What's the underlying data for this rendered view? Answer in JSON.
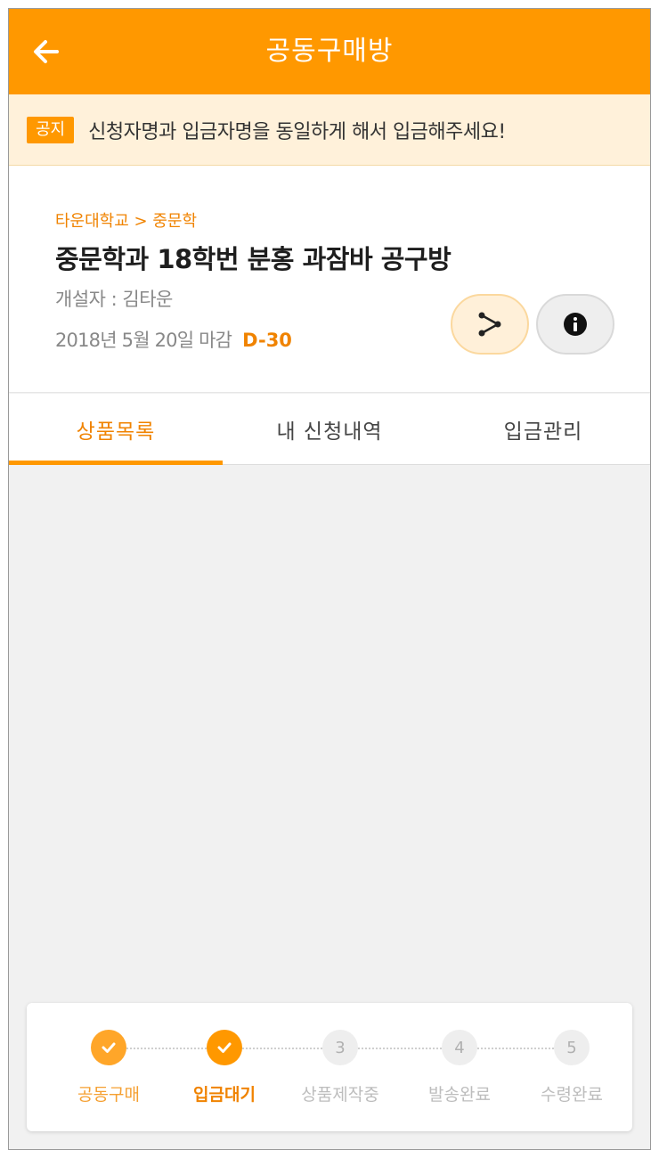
{
  "header": {
    "title": "공동구매방",
    "back_icon": "arrow-left-icon"
  },
  "notice": {
    "badge": "공지",
    "text": "신청자명과 입금자명을 동일하게 해서 입금해주세요!"
  },
  "room": {
    "breadcrumb": "타운대학교 > 중문학",
    "title": "중문학과 18학번 분홍 과잠바 공구방",
    "creator": "개설자 : 김타운",
    "deadline": "2018년 5월 20일 마감",
    "dday": "D-30",
    "share_icon": "share-icon",
    "info_icon": "info-icon"
  },
  "tabs": [
    {
      "label": "상품목록",
      "active": true
    },
    {
      "label": "내 신청내역",
      "active": false
    },
    {
      "label": "입금관리",
      "active": false
    }
  ],
  "progress": {
    "steps": [
      {
        "label": "공동구매",
        "status": "done",
        "number": "1"
      },
      {
        "label": "입금대기",
        "status": "current",
        "number": "2"
      },
      {
        "label": "상품제작중",
        "status": "pending",
        "number": "3"
      },
      {
        "label": "발송완료",
        "status": "pending",
        "number": "4"
      },
      {
        "label": "수령완료",
        "status": "pending",
        "number": "5"
      }
    ]
  },
  "colors": {
    "accent": "#ff9800",
    "accent_text": "#f08300",
    "notice_bg": "#fff1da"
  }
}
